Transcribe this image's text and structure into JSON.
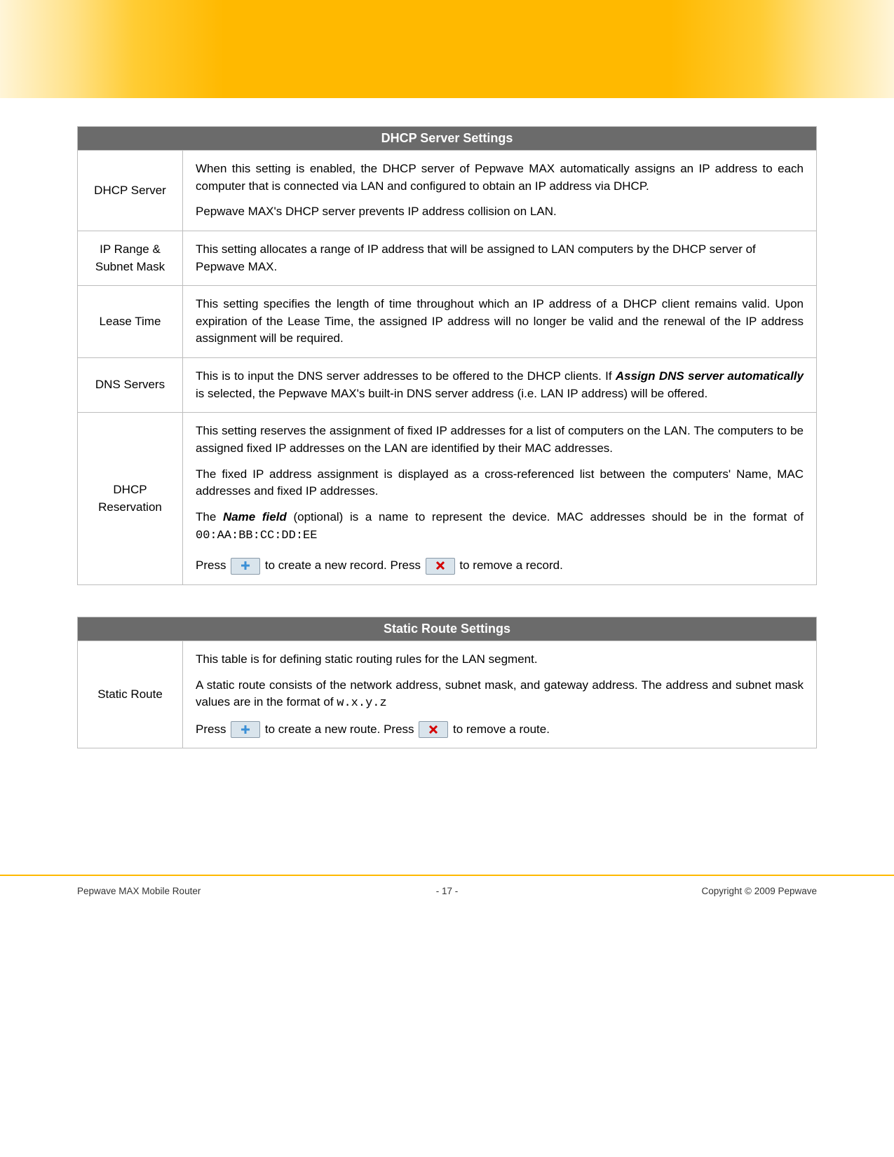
{
  "tables": {
    "dhcp": {
      "title": "DHCP Server Settings",
      "rows": {
        "dhcp_server": {
          "label": "DHCP Server",
          "p1": "When this setting is enabled, the DHCP server of Pepwave MAX automatically assigns an IP address to each computer that is connected via LAN and configured to obtain an IP address via DHCP.",
          "p2": "Pepwave MAX's DHCP server prevents IP address collision on LAN."
        },
        "ip_range": {
          "label": "IP Range & Subnet Mask",
          "p1": "This setting allocates a range of IP address that will be assigned to LAN computers by the DHCP server of Pepwave MAX."
        },
        "lease_time": {
          "label": "Lease Time",
          "p1": "This setting specifies the length of time throughout which an IP address of a DHCP client remains valid.  Upon expiration of the Lease Time, the assigned IP address will no longer be valid and the renewal of the IP address assignment will be required."
        },
        "dns_servers": {
          "label": "DNS Servers",
          "p1a": "This is to input the DNS server addresses to be offered to the DHCP clients.  If ",
          "p1_bi": "Assign DNS server automatically",
          "p1b": " is selected, the Pepwave MAX's built-in DNS server address (i.e. LAN IP address) will be offered."
        },
        "dhcp_reservation": {
          "label": "DHCP Reservation",
          "p1": "This setting reserves the assignment of fixed IP addresses for a list of computers on the LAN.  The computers to be assigned fixed IP addresses on the LAN are identified by their MAC addresses.",
          "p2": "The fixed IP address assignment is displayed as a cross-referenced list between the computers' Name, MAC addresses and fixed IP addresses.",
          "p3a": "The ",
          "p3_bi": "Name field",
          "p3b": " (optional) is a name to represent the device.  MAC addresses should be in the format of ",
          "p3_mono": "00:AA:BB:CC:DD:EE",
          "p4a": "Press ",
          "p4b": " to create a new record. Press ",
          "p4c": " to remove a record."
        }
      }
    },
    "static": {
      "title": "Static Route Settings",
      "rows": {
        "static_route": {
          "label": "Static Route",
          "p1": "This table is for defining static routing rules for the LAN segment.",
          "p2a": "A static route consists of the network address, subnet mask, and gateway address.  The address and subnet mask values are in the format of ",
          "p2_mono": "w.x.y.z",
          "p3a": "Press ",
          "p3b": " to create a new route. Press ",
          "p3c": " to remove a route."
        }
      }
    }
  },
  "footer": {
    "left": "Pepwave MAX Mobile Router",
    "center": "- 17 -",
    "right": "Copyright © 2009 Pepwave"
  }
}
